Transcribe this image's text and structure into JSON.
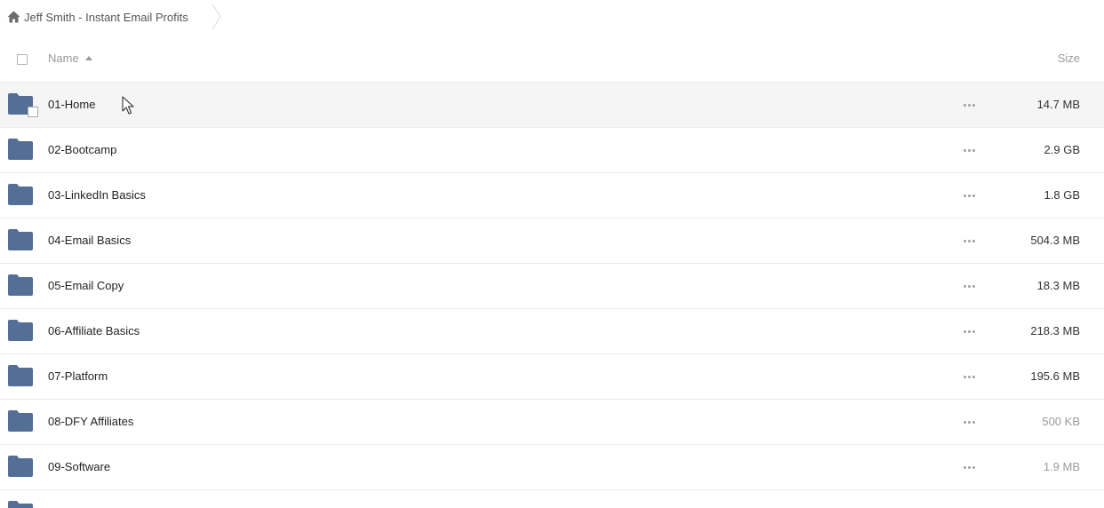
{
  "breadcrumb": {
    "home_icon": "home-icon",
    "label": "Jeff Smith - Instant Email Profits"
  },
  "table": {
    "columns": {
      "name": "Name",
      "size": "Size"
    },
    "sort": {
      "column": "name",
      "direction": "ascending",
      "icon": "sort-ascending-icon"
    },
    "folder_color": "#536f96",
    "rows": [
      {
        "name": "01-Home",
        "size": "14.7 MB"
      },
      {
        "name": "02-Bootcamp",
        "size": "2.9 GB"
      },
      {
        "name": "03-LinkedIn Basics",
        "size": "1.8 GB"
      },
      {
        "name": "04-Email Basics",
        "size": "504.3 MB"
      },
      {
        "name": "05-Email Copy",
        "size": "18.3 MB"
      },
      {
        "name": "06-Affiliate Basics",
        "size": "218.3 MB"
      },
      {
        "name": "07-Platform",
        "size": "195.6 MB"
      },
      {
        "name": "08-DFY Affiliates",
        "size": "500 KB"
      },
      {
        "name": "09-Software",
        "size": "1.9 MB"
      }
    ],
    "row_more_icon": "more-horizontal-icon",
    "hovered_row": "01-Home"
  }
}
